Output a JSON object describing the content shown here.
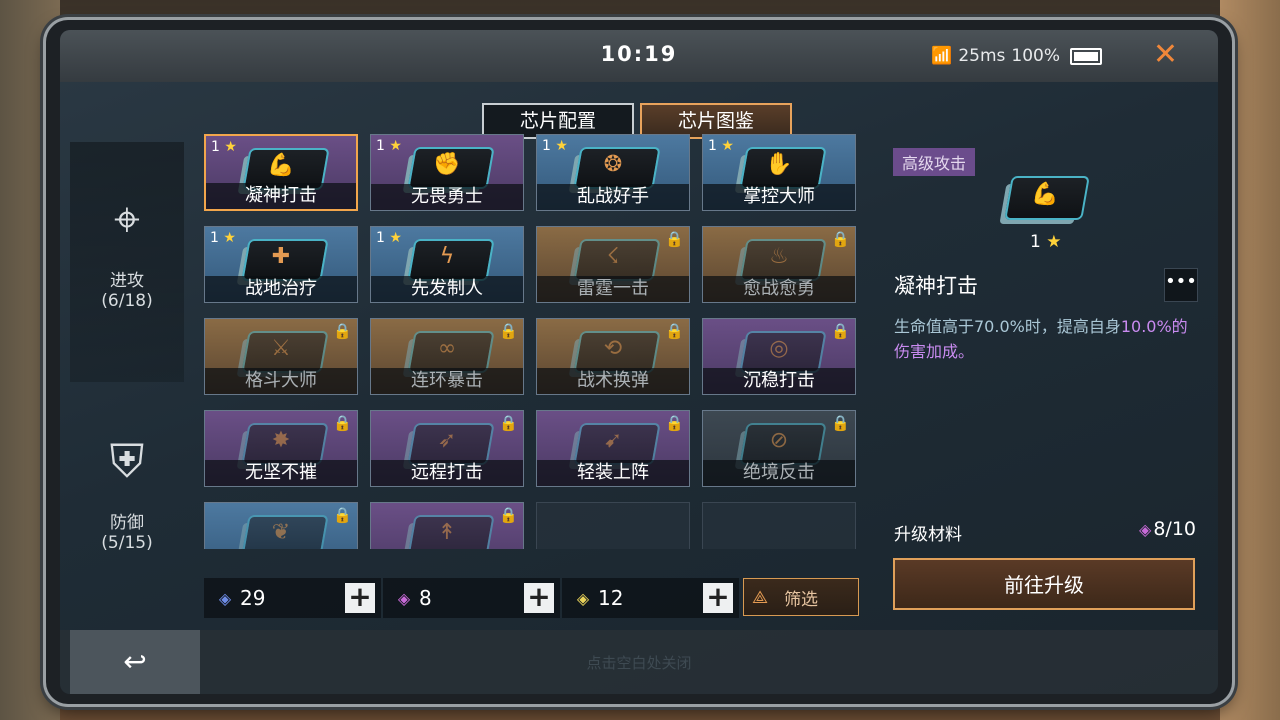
{
  "status": {
    "time": "10:19",
    "ping": "25ms",
    "battery": "100%"
  },
  "tabs": [
    {
      "label": "芯片配置",
      "active": false
    },
    {
      "label": "芯片图鉴",
      "active": true
    }
  ],
  "sidebar": {
    "attack": {
      "label": "进攻",
      "count": "(6/18)"
    },
    "defense": {
      "label": "防御",
      "count": "(5/15)"
    }
  },
  "chips": [
    {
      "name": "凝神打击",
      "stars": "1",
      "tier": "purple",
      "locked": false,
      "glyph": "bicep"
    },
    {
      "name": "无畏勇士",
      "stars": "1",
      "tier": "purple",
      "locked": false,
      "glyph": "fist"
    },
    {
      "name": "乱战好手",
      "stars": "1",
      "tier": "blue",
      "locked": false,
      "glyph": "swirl"
    },
    {
      "name": "掌控大师",
      "stars": "1",
      "tier": "blue",
      "locked": false,
      "glyph": "hand"
    },
    {
      "name": "战地治疗",
      "stars": "1",
      "tier": "blue",
      "locked": false,
      "glyph": "medkit"
    },
    {
      "name": "先发制人",
      "stars": "1",
      "tier": "blue",
      "locked": false,
      "glyph": "bolt"
    },
    {
      "name": "雷霆一击",
      "stars": "",
      "tier": "gold",
      "locked": true,
      "glyph": "thunder"
    },
    {
      "name": "愈战愈勇",
      "stars": "",
      "tier": "gold",
      "locked": true,
      "glyph": "flame"
    },
    {
      "name": "格斗大师",
      "stars": "",
      "tier": "gold",
      "locked": true,
      "glyph": "blade"
    },
    {
      "name": "连环暴击",
      "stars": "",
      "tier": "gold",
      "locked": true,
      "glyph": "chain"
    },
    {
      "name": "战术换弹",
      "stars": "",
      "tier": "gold",
      "locked": true,
      "glyph": "reload"
    },
    {
      "name": "沉稳打击",
      "stars": "",
      "tier": "purple",
      "locked": true,
      "glyph": "target"
    },
    {
      "name": "无坚不摧",
      "stars": "",
      "tier": "purple",
      "locked": true,
      "glyph": "crush"
    },
    {
      "name": "远程打击",
      "stars": "",
      "tier": "purple",
      "locked": true,
      "glyph": "arrows"
    },
    {
      "name": "轻装上阵",
      "stars": "",
      "tier": "purple",
      "locked": true,
      "glyph": "feather"
    },
    {
      "name": "绝境反击",
      "stars": "",
      "tier": "gray",
      "locked": true,
      "glyph": "counter"
    },
    {
      "name": "",
      "stars": "",
      "tier": "blue",
      "locked": true,
      "glyph": "wing"
    },
    {
      "name": "",
      "stars": "",
      "tier": "purple",
      "locked": true,
      "glyph": "spear"
    },
    {
      "name": "",
      "stars": "",
      "tier": "empty",
      "locked": false,
      "glyph": ""
    },
    {
      "name": "",
      "stars": "",
      "tier": "empty",
      "locked": false,
      "glyph": ""
    }
  ],
  "resources": [
    {
      "value": "29",
      "gem_color": "#6f8de8"
    },
    {
      "value": "8",
      "gem_color": "#c86ad8"
    },
    {
      "value": "12",
      "gem_color": "#e8d25a"
    }
  ],
  "filter_label": "筛选",
  "detail": {
    "tag": "高级攻击",
    "stars": "1",
    "title": "凝神打击",
    "more": "•••",
    "desc_part1": "生命值高于70.0%时，提高自身",
    "desc_highlight": "10.0%",
    "desc_part2": "的伤害加成。",
    "material_label": "升级材料",
    "material_value": "8/10",
    "upgrade_label": "前往升级"
  },
  "hint": "点击空白处关闭",
  "colors": {
    "accent_orange": "#e8a35c",
    "star_yellow": "#ffd23a",
    "highlight_purple": "#c98bf0"
  }
}
